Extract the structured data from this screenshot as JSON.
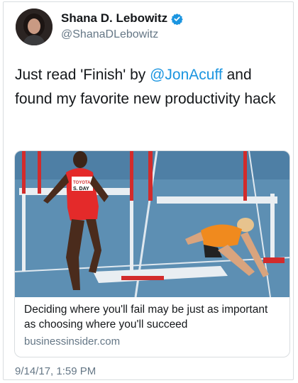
{
  "author": {
    "display_name": "Shana D. Lebowitz",
    "handle": "@ShanaDLebowitz",
    "verified": true,
    "avatar_icon": "profile-photo"
  },
  "tweet": {
    "text_before": "Just read 'Finish' by ",
    "mention": "@JonAcuff",
    "text_after": " and found my favorite new productivity hack"
  },
  "link_card": {
    "image_icon": "hurdle-race-photo",
    "bib_label": "S. DAY",
    "title": "Deciding where you'll fail may be just as important as choosing where you'll succeed",
    "domain": "businessinsider.com"
  },
  "timestamp": "9/14/17, 1:59 PM",
  "colors": {
    "link": "#1b95e0",
    "secondary_text": "#657786",
    "border": "#d9dde0",
    "track_blue": "#5d8fb3"
  }
}
